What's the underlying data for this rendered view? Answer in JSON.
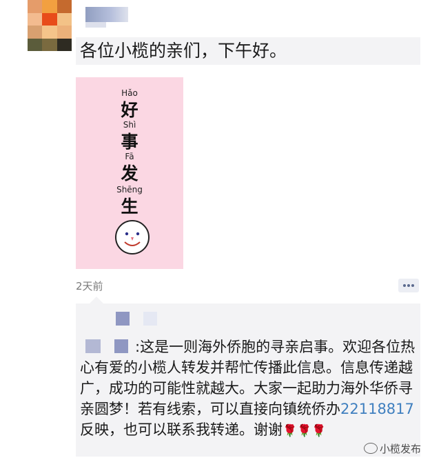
{
  "post": {
    "avatar_colors": [
      "#e59c6a",
      "#f2a040",
      "#c56a2e",
      "#f3bb8f",
      "#e84c1a",
      "#f3c287",
      "#d8a070",
      "#f5c48a",
      "#ecb17a",
      "#5b5c3b",
      "#7a6a3f",
      "#2e2b22"
    ],
    "greeting": "各位小榄的亲们，下午好。",
    "image": {
      "lines": [
        {
          "pinyin": "Hǎo",
          "char": "好"
        },
        {
          "pinyin": "Shì",
          "char": "事"
        },
        {
          "pinyin": "Fā",
          "char": "发"
        },
        {
          "pinyin": "Shēng",
          "char": "生"
        }
      ],
      "background": "#fbd7e3"
    },
    "timestamp": "2天前"
  },
  "comment": {
    "text_before": ":这是一则海外侨胞的寻亲启事。欢迎各位热心有爱的小榄人转发并帮忙传播此信息。信息传递越广，成功的可能性就越大。大家一起助力海外华侨寻亲圆梦！若有线索，可以直接向镇统侨办",
    "phone": "22118817",
    "text_after": "反映，也可以联系我转递。谢谢",
    "flowers": "🌹🌹🌹"
  },
  "watermark": {
    "label": "小榄发布"
  },
  "icons": {
    "comment": "comment-icon",
    "watermark": "wechat-icon"
  }
}
